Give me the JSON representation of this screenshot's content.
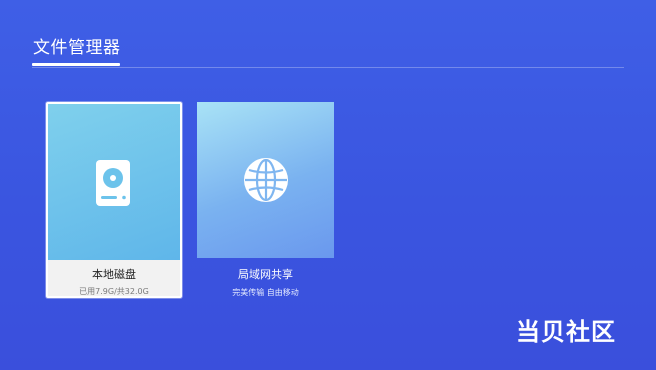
{
  "header": {
    "title": "文件管理器"
  },
  "tiles": [
    {
      "label": "本地磁盘",
      "subtitle": "已用7.9G/共32.0G",
      "icon": "hard-disk-icon",
      "selected": true
    },
    {
      "label": "局域网共享",
      "subtitle": "完美传输 自由移动",
      "icon": "globe-icon",
      "selected": false
    }
  ],
  "watermark": {
    "text": "当贝社区"
  },
  "colors": {
    "background": "#3a55e0",
    "tile_local_art": "#6cc3eb",
    "tile_network_art": "#86bdf2",
    "tile_focus_bg": "#f2f2f2"
  }
}
